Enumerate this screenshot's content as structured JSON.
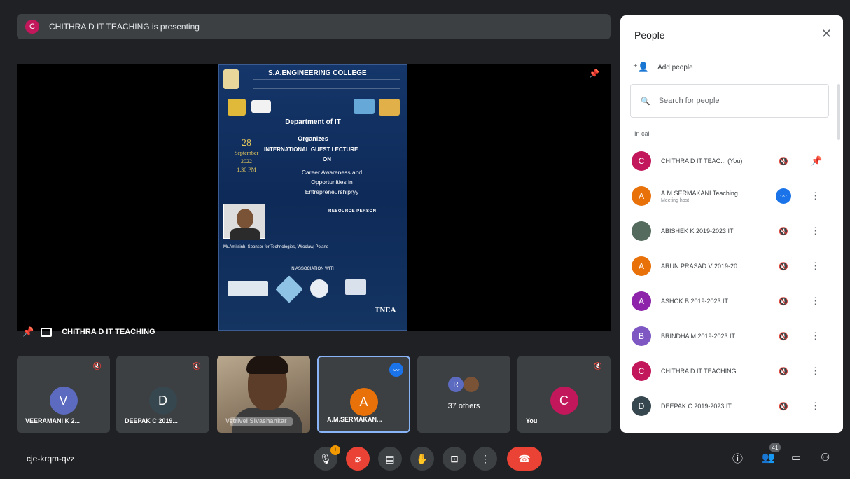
{
  "banner": {
    "avatar": "C",
    "text": "CHITHRA D IT TEACHING is presenting"
  },
  "poster": {
    "college": "S.A.ENGINEERING COLLEGE",
    "dept": "Department of IT",
    "organizes": "Organizes",
    "lecture": "INTERNATIONAL GUEST LECTURE",
    "on": "ON",
    "topic": "Career Awareness and Opportunities in Entrepreneurshipryy",
    "date_day": "28",
    "date_month": "September",
    "date_year": "2022",
    "date_time": "1.30 PM",
    "resource": "RESOURCE PERSON",
    "speaker": "Mr.Amitsinh, Sponsor for Technologies, Wroclaw, Poland",
    "assoc": "IN ASSOCIATION WITH",
    "tnea": "TNEA"
  },
  "presenter": {
    "name": "CHITHRA D IT TEACHING"
  },
  "tiles": [
    {
      "avatar": "V",
      "name": "VEERAMANI K 2...",
      "color": "#5c6bc0"
    },
    {
      "avatar": "D",
      "name": "DEEPAK C 2019...",
      "color": "#37474f"
    },
    {
      "name": "Vetrivel Sivashankar"
    },
    {
      "avatar": "A",
      "name": "A.M.SERMAKAN...",
      "color": "#e8710a"
    },
    {
      "avatar1": "R",
      "count": "37 others"
    },
    {
      "avatar": "C",
      "name": "You",
      "color": "#c2185b"
    }
  ],
  "meeting_code": "cje-krqm-qvz",
  "controls": {
    "mic_badge": "!",
    "people_count": "41"
  },
  "panel": {
    "title": "People",
    "add_people": "Add people",
    "search_placeholder": "Search for people",
    "in_call": "In call",
    "people": [
      {
        "avatar": "C",
        "name": "CHITHRA D IT TEAC... (You)",
        "color": "#c2185b"
      },
      {
        "avatar": "A",
        "name": "A.M.SERMAKANI Teaching",
        "role": "Meeting host",
        "color": "#e8710a"
      },
      {
        "avatar": "",
        "name": "ABISHEK K 2019-2023 IT",
        "color": "#556b5d"
      },
      {
        "avatar": "A",
        "name": "ARUN PRASAD V 2019-20...",
        "color": "#e8710a"
      },
      {
        "avatar": "A",
        "name": "ASHOK B 2019-2023 IT",
        "color": "#8e24aa"
      },
      {
        "avatar": "B",
        "name": "BRINDHA M 2019-2023 IT",
        "color": "#7e57c2"
      },
      {
        "avatar": "C",
        "name": "CHITHRA D IT TEACHING",
        "color": "#c2185b"
      },
      {
        "avatar": "D",
        "name": "DEEPAK C 2019-2023 IT",
        "color": "#37474f"
      }
    ]
  },
  "colors": {
    "background": "#202124",
    "tile": "#3c4043",
    "accent": "#1a73e8",
    "danger": "#ea4335"
  }
}
